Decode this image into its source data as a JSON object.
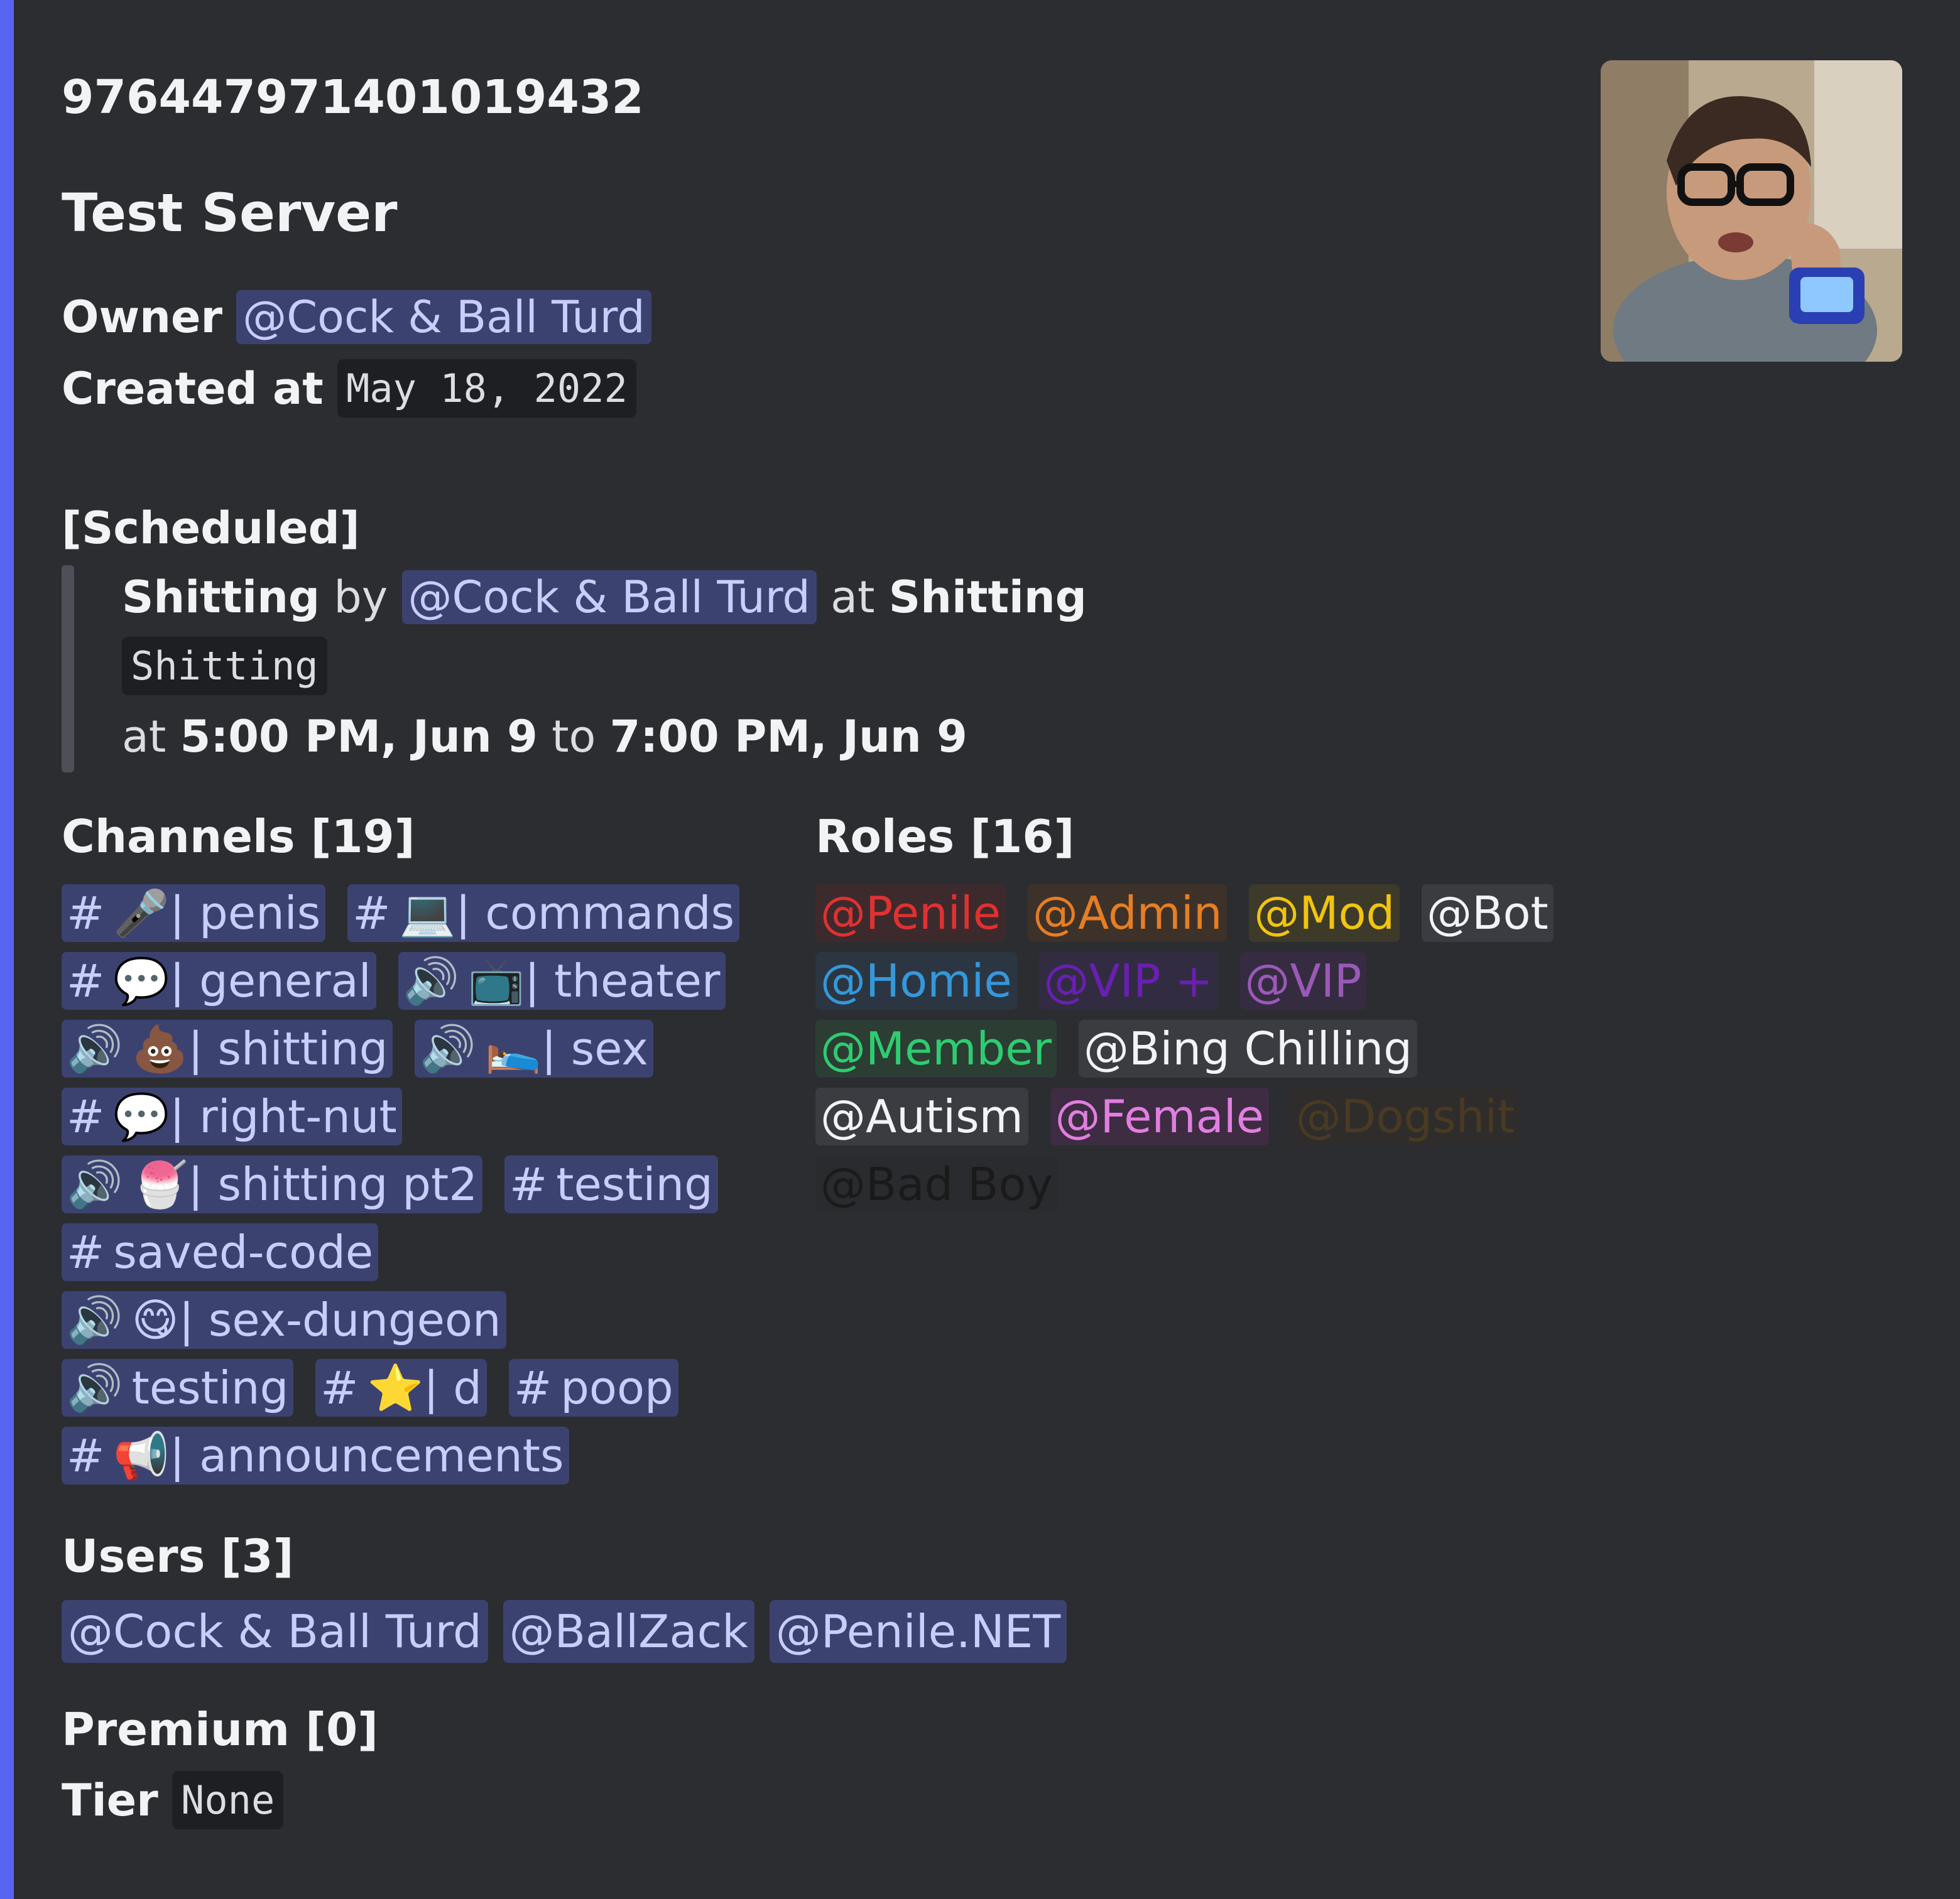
{
  "embed": {
    "accent_color": "#5865f2",
    "server_id": "976447971401019432",
    "server_name": "Test Server",
    "owner_label": "Owner",
    "owner_mention": "@Cock & Ball Turd",
    "created_label": "Created at",
    "created_value": "May 18, 2022",
    "scheduled": {
      "heading": "[Scheduled]",
      "event_name": "Shitting",
      "by_word": "by",
      "organizer": "@Cock & Ball Turd",
      "at_word": "at",
      "location": "Shitting",
      "description": "Shitting",
      "time_prefix": "at",
      "start": "5:00 PM, Jun 9",
      "to_word": "to",
      "end": "7:00 PM, Jun 9"
    },
    "channels": {
      "heading": "Channels [19]",
      "items": [
        {
          "symbol": "#",
          "label": "🎤| penis"
        },
        {
          "symbol": "#",
          "label": "💻| commands"
        },
        {
          "symbol": "#",
          "label": "💬| general"
        },
        {
          "symbol": "🔊",
          "label": "📺| theater"
        },
        {
          "symbol": "🔊",
          "label": "💩| shitting"
        },
        {
          "symbol": "🔊",
          "label": "🛌| sex"
        },
        {
          "symbol": "#",
          "label": "💬| right-nut"
        },
        {
          "symbol": "🔊",
          "label": "🍧| shitting pt2"
        },
        {
          "symbol": "#",
          "label": "testing"
        },
        {
          "symbol": "#",
          "label": "saved-code"
        },
        {
          "symbol": "🔊",
          "label": "😋| sex-dungeon"
        },
        {
          "symbol": "🔊",
          "label": "testing"
        },
        {
          "symbol": "#",
          "label": "⭐| d"
        },
        {
          "symbol": "#",
          "label": "poop"
        },
        {
          "symbol": "#",
          "label": "📢| announcements"
        }
      ]
    },
    "roles": {
      "heading": "Roles [16]",
      "items": [
        {
          "label": "@Penile",
          "color": "#e03131",
          "bg": "#3d2a2d"
        },
        {
          "label": "@Admin",
          "color": "#e67e22",
          "bg": "#3d322a"
        },
        {
          "label": "@Mod",
          "color": "#f1c40f",
          "bg": "#3d3a2a"
        },
        {
          "label": "@Bot",
          "color": "#f2f3f5",
          "bg": "#3a3c42"
        },
        {
          "label": "@Homie",
          "color": "#3498db",
          "bg": "#2c3642"
        },
        {
          "label": "@VIP +",
          "color": "#6a1fb3",
          "bg": "#322c42"
        },
        {
          "label": "@VIP",
          "color": "#9b59b6",
          "bg": "#352c42"
        },
        {
          "label": "@Member",
          "color": "#2ecc71",
          "bg": "#2c3d33"
        },
        {
          "label": "@Bing Chilling",
          "color": "#f2f3f5",
          "bg": "#3a3c42"
        },
        {
          "label": "@Autism",
          "color": "#f2f3f5",
          "bg": "#3a3c42"
        },
        {
          "label": "@Female",
          "color": "#e27ee0",
          "bg": "#3d2c42"
        },
        {
          "label": "@Dogshit",
          "color": "#4a3a22",
          "bg": "#2e2d2b"
        },
        {
          "label": "@Bad Boy",
          "color": "#1a1a1a",
          "bg": "#2a2b2e"
        }
      ]
    },
    "users": {
      "heading": "Users [3]",
      "items": [
        "@Cock & Ball Turd",
        "@BallZack",
        "@Penile.NET"
      ]
    },
    "premium": {
      "heading": "Premium [0]",
      "tier_label": "Tier",
      "tier_value": "None"
    }
  }
}
